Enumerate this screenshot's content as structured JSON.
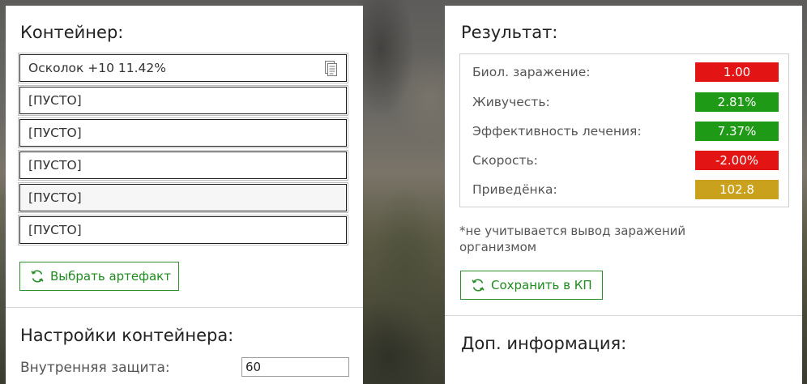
{
  "container": {
    "title": "Контейнер:",
    "slots": [
      {
        "label": "Осколок +10 11.42%"
      },
      {
        "label": "[ПУСТО]"
      },
      {
        "label": "[ПУСТО]"
      },
      {
        "label": "[ПУСТО]"
      },
      {
        "label": "[ПУСТО]"
      },
      {
        "label": "[ПУСТО]"
      }
    ],
    "choose_button": "Выбрать артефакт"
  },
  "settings": {
    "title": "Настройки контейнера:",
    "inner_protection_label": "Внутренняя защита:",
    "inner_protection_value": "60"
  },
  "result": {
    "title": "Результат:",
    "rows": [
      {
        "label": "Биол. заражение:",
        "value": "1.00",
        "color": "#e21414"
      },
      {
        "label": "Живучесть:",
        "value": "2.81%",
        "color": "#1f9a17"
      },
      {
        "label": "Эффективность лечения:",
        "value": "7.37%",
        "color": "#1f9a17"
      },
      {
        "label": "Скорость:",
        "value": "-2.00%",
        "color": "#e21414"
      },
      {
        "label": "Приведёнка:",
        "value": "102.8",
        "color": "#c9a11d"
      }
    ],
    "note": "*не учитывается вывод заражений организмом",
    "save_button": "Сохранить в КП"
  },
  "extra": {
    "title": "Доп. информация:"
  }
}
